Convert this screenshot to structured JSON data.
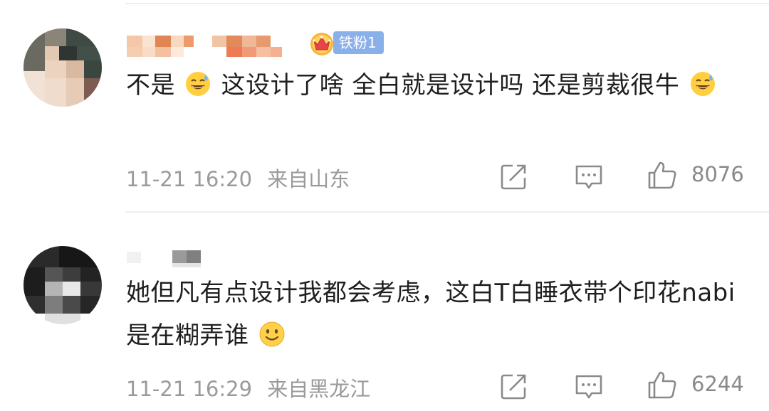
{
  "comments": [
    {
      "badge": "铁粉1",
      "text_parts": [
        "不是",
        "这设计了啥 全白就是设计吗 还是剪裁很牛"
      ],
      "time": "11-21 16:20",
      "location": "来自山东",
      "likes": "8076",
      "emojis": [
        "sweat-smile-emoji",
        "sweat-smile-emoji"
      ]
    },
    {
      "text_parts": [
        "她但凡有点设计我都会考虑，这白T白睡衣带个印花nabi是在糊弄谁"
      ],
      "time": "11-21 16:29",
      "location": "来自黑龙江",
      "likes": "6244",
      "emojis": [
        "smile-emoji"
      ]
    }
  ],
  "icons": [
    "share-icon",
    "comment-icon",
    "like-icon",
    "crown-icon"
  ],
  "colors": {
    "accent_badge": "#8ab0ea",
    "meta_text": "#9a9a9a",
    "divider": "#efefef"
  }
}
